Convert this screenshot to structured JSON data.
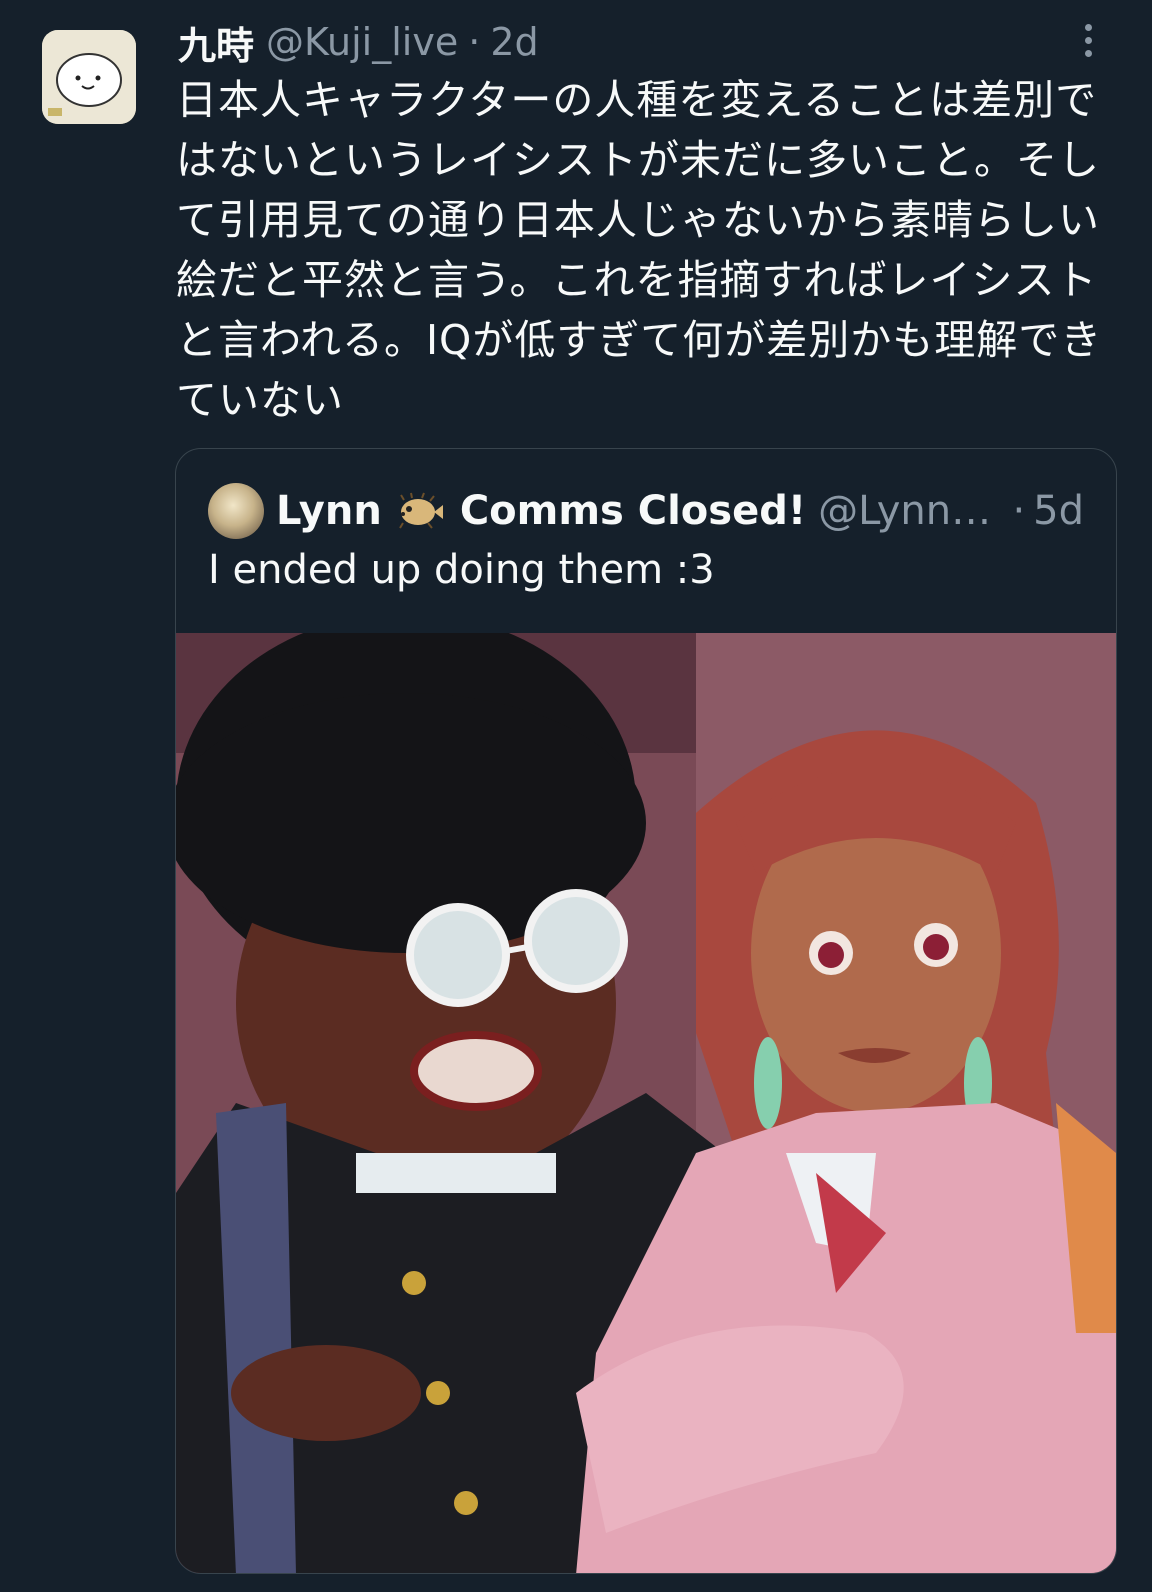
{
  "tweet": {
    "display_name": "九時",
    "handle": "@Kuji_live",
    "separator": "·",
    "time": "2d",
    "text": "日本人キャラクターの人種を変えることは差別ではないというレイシストが未だに多いこと。そして引用見ての通り日本人じゃないから素晴らしい絵だと平然と言う。これを指摘すればレイシストと言われる。IQが低すぎて何が差別かも理解できていない",
    "more_icon": "more-vertical-icon"
  },
  "quote": {
    "display_name": "Lynn",
    "emoji_icon": "pufferfish-icon",
    "display_name_suffix": "Comms Closed!",
    "handle": "@Lynn…",
    "separator": "·",
    "time": "5d",
    "text": "I ended up doing them :3",
    "image_alt_icon": "illustration-image"
  },
  "colors": {
    "background": "#15202b",
    "primary_text": "#f7f9f9",
    "secondary_text": "#8b98a5",
    "border": "#38444d"
  }
}
